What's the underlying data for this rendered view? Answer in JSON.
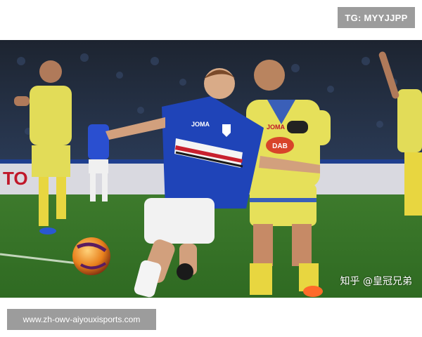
{
  "top_badge": {
    "text": "TG: MYYJJPP"
  },
  "photo": {
    "watermark": "知乎 @皇冠兄弟",
    "ad_board_text": "TO",
    "home_kit_sponsor": "JOMA",
    "away_kit_sponsor": "JOMA",
    "away_shirt_text": "DAB"
  },
  "bottom_badge": {
    "text": "www.zh-owv-aiyouxisports.com"
  },
  "colors": {
    "home_blue": "#1f44b8",
    "away_yellow": "#e6e05a",
    "pitch_green": "#3f7f2f",
    "badge_gray": "#9c9c9c"
  }
}
